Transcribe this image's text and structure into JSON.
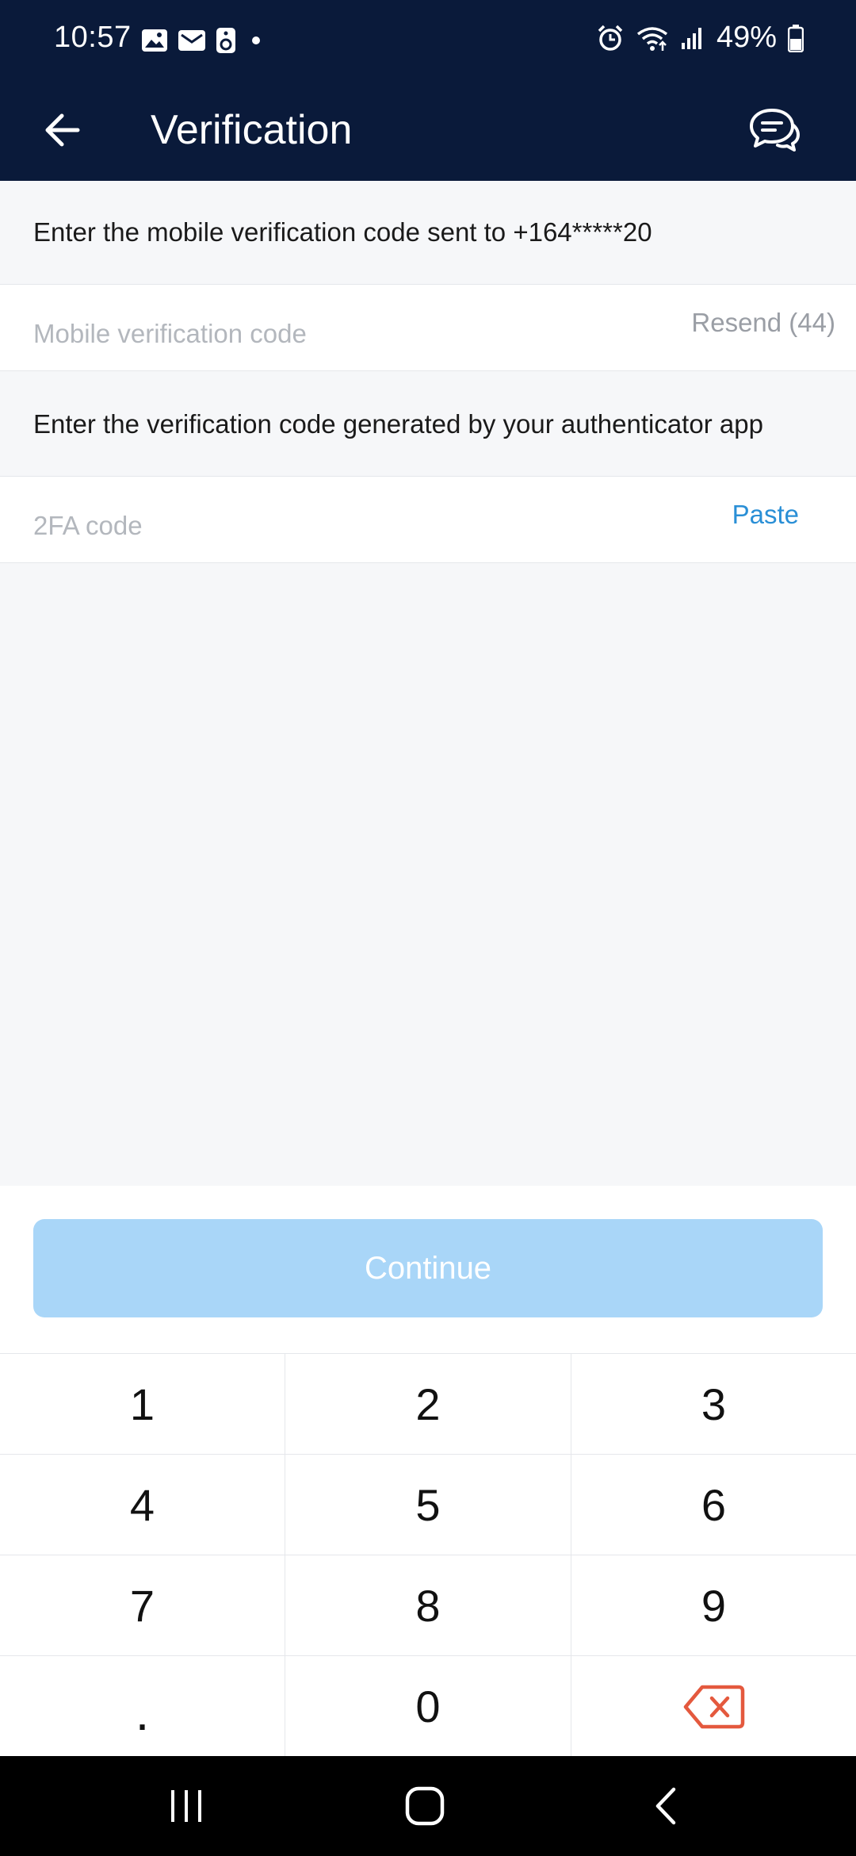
{
  "status_bar": {
    "time": "10:57",
    "battery": "49%"
  },
  "app_bar": {
    "title": "Verification"
  },
  "sms_section": {
    "instruction": "Enter the mobile verification code sent to +164*****20",
    "placeholder": "Mobile verification code",
    "resend_label": "Resend (44)"
  },
  "twofa_section": {
    "instruction": "Enter the verification code generated by your authenticator app",
    "placeholder": "2FA code",
    "paste_label": "Paste"
  },
  "continue_label": "Continue",
  "keypad": {
    "keys": [
      "1",
      "2",
      "3",
      "4",
      "5",
      "6",
      "7",
      "8",
      "9",
      ".",
      "0"
    ]
  },
  "colors": {
    "header_bg": "#0a1a3a",
    "accent": "#2a8fd6",
    "continue_disabled": "#a9d6f8",
    "delete_key": "#e4593e"
  }
}
